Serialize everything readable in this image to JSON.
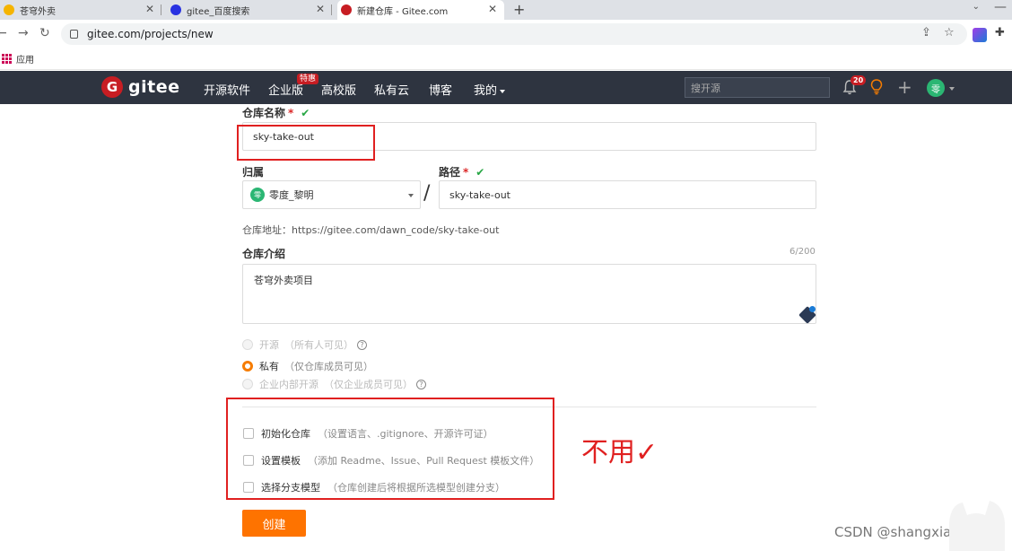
{
  "browser": {
    "tabs": [
      {
        "title": "苍穹外卖",
        "fav_color": "#f5b400"
      },
      {
        "title": "gitee_百度搜索",
        "fav_color": "#2932e1"
      },
      {
        "title": "新建仓库 - Gitee.com",
        "fav_color": "#c71d23"
      }
    ],
    "url": "gitee.com/projects/new",
    "bookmark": "应用"
  },
  "gitee_header": {
    "logo_letter": "G",
    "logo_text": "gitee",
    "nav": [
      "开源软件",
      "企业版",
      "高校版",
      "私有云",
      "博客",
      "我的"
    ],
    "hot_badge": "特惠",
    "search_placeholder": "搜开源",
    "notification_count": "20",
    "avatar_letter": "零"
  },
  "form": {
    "repo_name_label": "仓库名称",
    "repo_name_value": "sky-take-out",
    "owner_label": "归属",
    "owner_value": "零度_黎明",
    "owner_avatar": "零",
    "path_label": "路径",
    "path_value": "sky-take-out",
    "address_hint": "仓库地址：https://gitee.com/dawn_code/sky-take-out",
    "intro_label": "仓库介绍",
    "intro_counter": "6/200",
    "intro_value": "苍穹外卖项目",
    "visibility": [
      {
        "label": "开源",
        "note": "（所有人可见）",
        "selected": false,
        "disabled": true,
        "help": true
      },
      {
        "label": "私有",
        "note": "（仅仓库成员可见）",
        "selected": true,
        "disabled": false,
        "help": false
      },
      {
        "label": "企业内部开源",
        "note": "（仅企业成员可见）",
        "selected": false,
        "disabled": true,
        "help": true
      }
    ],
    "options": [
      {
        "label": "初始化仓库",
        "note": "（设置语言、.gitignore、开源许可证）"
      },
      {
        "label": "设置模板",
        "note": "（添加 Readme、Issue、Pull Request 模板文件）"
      },
      {
        "label": "选择分支模型",
        "note": "（仓库创建后将根据所选模型创建分支）"
      }
    ],
    "create_button": "创建"
  },
  "annotation": "不用✓",
  "watermark": "CSDN @shangxianjiao"
}
